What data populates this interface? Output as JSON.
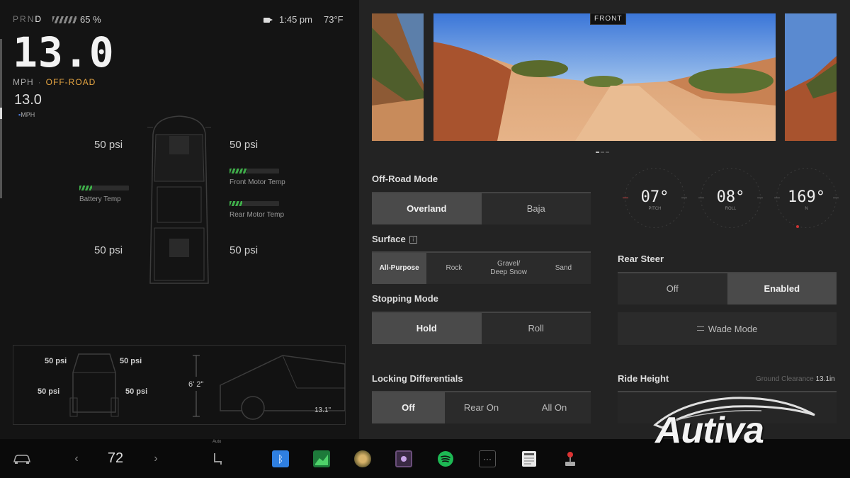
{
  "status": {
    "gears": [
      "P",
      "R",
      "N",
      "D"
    ],
    "active_gear": "D",
    "battery_percent": "65 %",
    "time": "1:45 pm",
    "outside_temp": "73°F"
  },
  "speed": {
    "value": "13.0",
    "unit": "MPH",
    "separator": "·",
    "mode": "OFF-ROAD",
    "limit_value": "13.0",
    "limit_unit": "MPH"
  },
  "tires": {
    "front_left": "50 psi",
    "front_right": "50 psi",
    "rear_left": "50 psi",
    "rear_right": "50 psi"
  },
  "temps": {
    "battery_label": "Battery Temp",
    "battery_level": 0.25,
    "front_motor_label": "Front Motor Temp",
    "front_motor_level": 0.35,
    "rear_motor_label": "Rear Motor Temp",
    "rear_motor_level": 0.25
  },
  "rear_view": {
    "psi_fl": "50 psi",
    "psi_fr": "50 psi",
    "psi_rl": "50 psi",
    "psi_rr": "50 psi",
    "vehicle_height": "6' 2\"",
    "clearance": "13.1\""
  },
  "cameras": {
    "front_label": "FRONT"
  },
  "off_road_mode": {
    "title": "Off-Road Mode",
    "options": [
      "Overland",
      "Baja"
    ],
    "active": 0
  },
  "surface": {
    "title": "Surface",
    "info_glyph": "i",
    "options": [
      "All-Purpose",
      "Rock",
      "Gravel/\nDeep Snow",
      "Sand"
    ],
    "active": 0
  },
  "stopping_mode": {
    "title": "Stopping Mode",
    "options": [
      "Hold",
      "Roll"
    ],
    "active": 0
  },
  "locking_differentials": {
    "title": "Locking Differentials",
    "options": [
      "Off",
      "Rear On",
      "All On"
    ],
    "active": 0
  },
  "gauges": [
    {
      "value": "07°",
      "label": "PITCH"
    },
    {
      "value": "08°",
      "label": "ROLL"
    },
    {
      "value": "169°",
      "label": "N"
    }
  ],
  "rear_steer": {
    "title": "Rear Steer",
    "options": [
      "Off",
      "Enabled"
    ],
    "active": 1
  },
  "wade_mode": {
    "label": "Wade Mode"
  },
  "ride_height": {
    "title": "Ride Height",
    "clearance_label": "Ground Clearance",
    "clearance_value": "13.1in"
  },
  "taskbar": {
    "cabin_temp": "72",
    "seat_label": "Auto",
    "chev_left": "‹",
    "chev_right": "›",
    "dots": "···"
  },
  "watermark": {
    "text": "Autiva"
  },
  "colors": {
    "mode_accent": "#e7a642",
    "temp_bar_green": "#3fae4a",
    "bluetooth_blue": "#2f7fe0",
    "spotify_green": "#1db954"
  }
}
